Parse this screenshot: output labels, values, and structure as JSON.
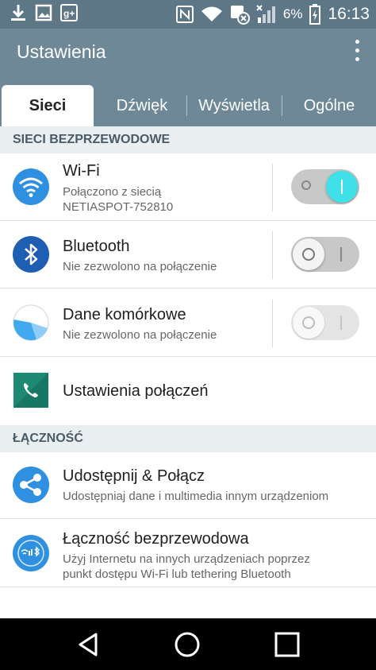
{
  "status_bar": {
    "battery_percent": "6%",
    "time": "16:13",
    "left_icons": [
      "download-icon",
      "image-icon",
      "google-plus-icon"
    ],
    "right_icons": [
      "nfc-icon",
      "wifi-icon",
      "data-saver-icon",
      "signal-icon",
      "battery-icon"
    ]
  },
  "app_bar": {
    "title": "Ustawienia",
    "menu_icon": "overflow-menu-icon"
  },
  "tabs": [
    {
      "label": "Sieci",
      "active": true
    },
    {
      "label": "Dźwięk",
      "active": false
    },
    {
      "label": "Wyświetla",
      "active": false
    },
    {
      "label": "Ogólne",
      "active": false
    }
  ],
  "sections": {
    "wireless": {
      "header": "SIECI BEZPRZEWODOWE",
      "wifi": {
        "title": "Wi-Fi",
        "subtitle_line1": "Połączono z siecią",
        "subtitle_line2": "NETIASPOT-752810",
        "toggle_on": true
      },
      "bluetooth": {
        "title": "Bluetooth",
        "subtitle": "Nie zezwolono na połączenie",
        "toggle_on": false
      },
      "mobile_data": {
        "title": "Dane komórkowe",
        "subtitle": "Nie zezwolono na połączenie",
        "toggle_on": false,
        "toggle_disabled": true
      },
      "call_settings": {
        "title": "Ustawienia połączeń"
      }
    },
    "connectivity": {
      "header": "ŁĄCZNOŚĆ",
      "share": {
        "title": "Udostępnij & Połącz",
        "subtitle": "Udostępniaj dane i multimedia innym urządzeniom"
      },
      "tethering": {
        "title": "Łączność bezprzewodowa",
        "subtitle_line1": "Użyj Internetu na innych urządzeniach poprzez",
        "subtitle_line2": "punkt dostępu Wi-Fi lub tethering Bluetooth"
      }
    }
  },
  "colors": {
    "status_bar": "#5e7787",
    "app_bar": "#6e8898",
    "accent_toggle": "#3fe0e8",
    "section_header_bg": "#e9eef1"
  },
  "nav_bar": [
    "back-icon",
    "home-icon",
    "recents-icon"
  ]
}
